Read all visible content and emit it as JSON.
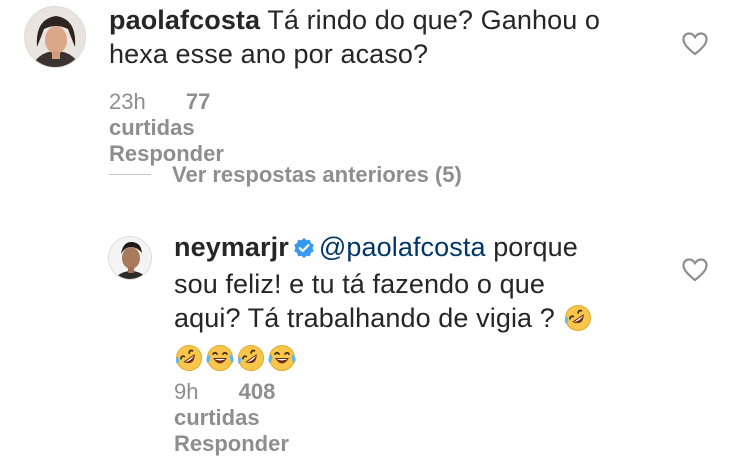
{
  "comment1": {
    "username": "paolafcosta",
    "text_line1": "Tá rindo do que? Ganhou o",
    "text_line2": "hexa esse ano por acaso?",
    "time": "23h",
    "likes": "77 curtidas",
    "reply": "Responder",
    "avatar_icon": "profile-photo",
    "like_icon": "heart-outline-icon"
  },
  "view_more": "Ver respostas anteriores (5)",
  "reply1": {
    "username": "neymarjr",
    "verified_icon": "verified-badge-icon",
    "mention": "@paolafcosta",
    "text_line1_rest": " porque",
    "text_line2": "sou feliz! e tu tá fazendo o que",
    "text_line3": "aqui? Tá trabalhando de vigia ?",
    "emojis": [
      "rolling-on-floor-laughing-emoji",
      "laughing-tears-emoji",
      "rolling-on-floor-laughing-emoji",
      "laughing-tears-emoji",
      "rolling-on-floor-laughing-emoji"
    ],
    "time": "9h",
    "likes": "408 curtidas",
    "reply": "Responder",
    "like_icon": "heart-outline-icon"
  },
  "colors": {
    "text": "#262626",
    "secondary": "#8e8e8e",
    "mention": "#00376b",
    "verified": "#3897f0",
    "emoji_face": "#f7c64a"
  }
}
